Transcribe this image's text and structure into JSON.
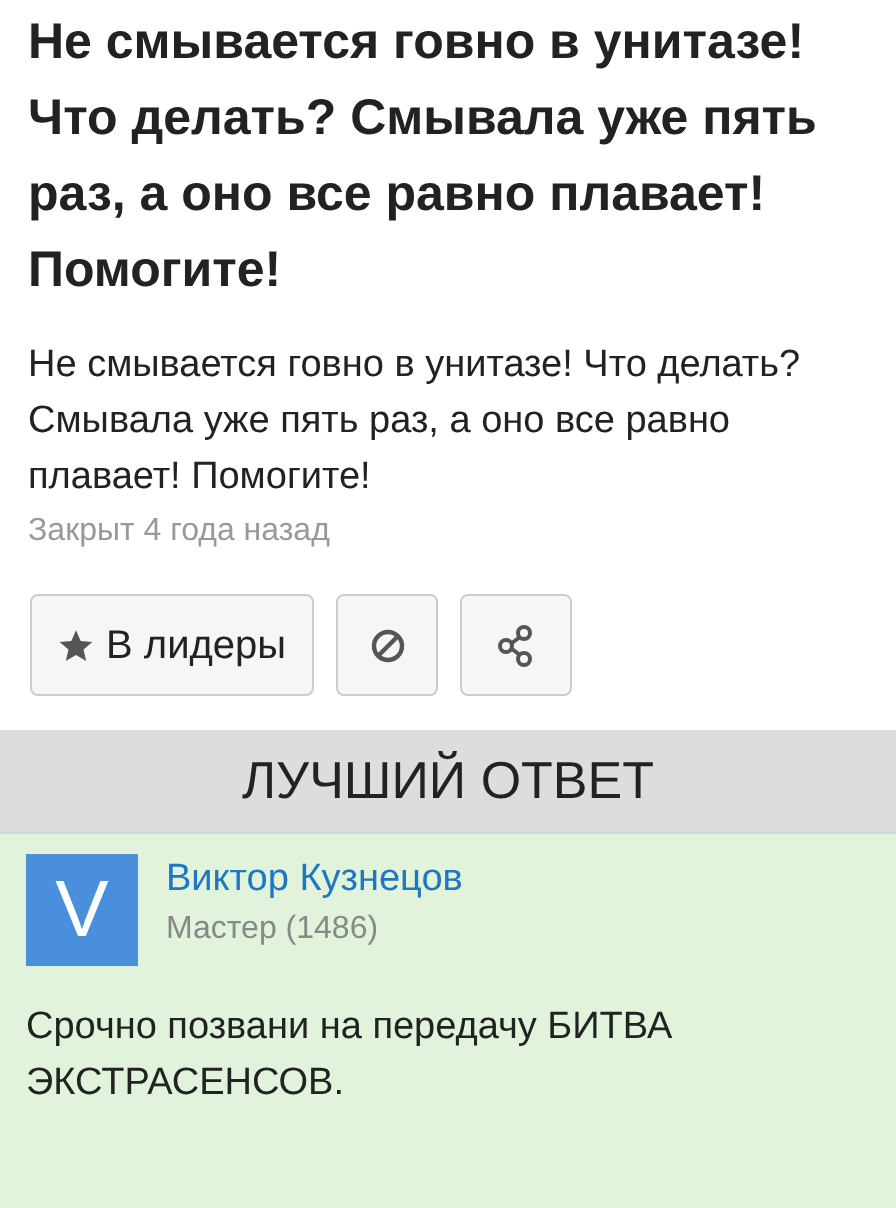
{
  "question": {
    "title": "Не смывается говно в унитазе! Что делать? Смывала уже пять раз, а оно все равно плавает! Помогите!",
    "body": "Не смывается говно в унитазе! Что делать? Смывала уже пять раз, а оно все равно плавает! Помогите!",
    "status": "Закрыт 4 года назад"
  },
  "actions": {
    "leaders_button": "В лидеры"
  },
  "best_answer": {
    "heading": "ЛУЧШИЙ ОТВЕТ",
    "avatar_letter": "V",
    "author": "Виктор Кузнецов",
    "rank": "Мастер (1486)",
    "text": "Срочно позвани на передачу БИТВА ЭКСТРАСЕНСОВ."
  }
}
